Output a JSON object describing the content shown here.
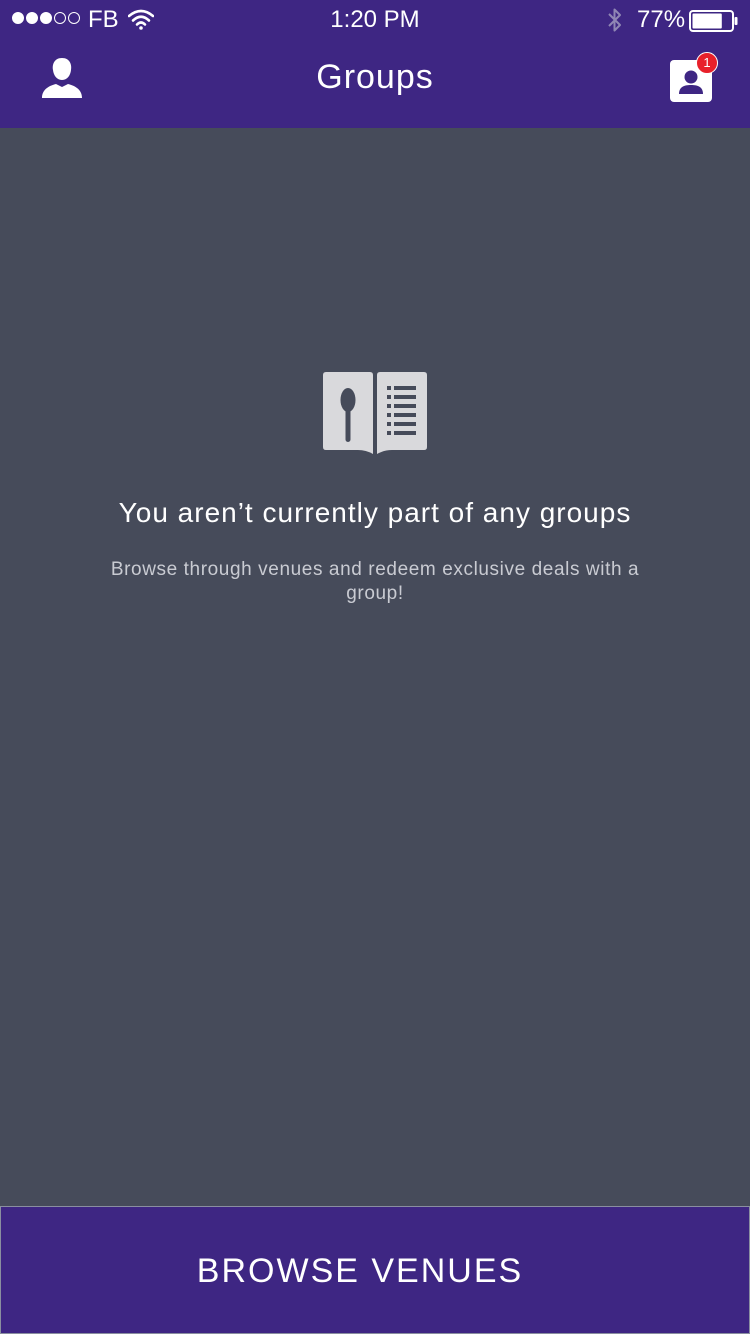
{
  "status_bar": {
    "signal_filled": 3,
    "signal_total": 5,
    "carrier": "FB",
    "time": "1:20 PM",
    "battery_percent_text": "77%",
    "battery_level": 0.77,
    "icons": [
      "wifi-icon",
      "bluetooth-icon",
      "battery-icon"
    ]
  },
  "header": {
    "title": "Groups",
    "left_icon": "profile-icon",
    "right_icon": "contacts-icon",
    "notification_count": "1"
  },
  "empty_state": {
    "icon": "menu-book-icon",
    "title": "You aren’t currently part of any groups",
    "subtitle": "Browse through venues and redeem exclusive deals with a group!"
  },
  "footer": {
    "button_label": "BROWSE VENUES"
  },
  "colors": {
    "brand_purple": "#3e2683",
    "background": "#464b5a",
    "badge_red": "#e8202a",
    "icon_gray": "#d9d9dc"
  }
}
